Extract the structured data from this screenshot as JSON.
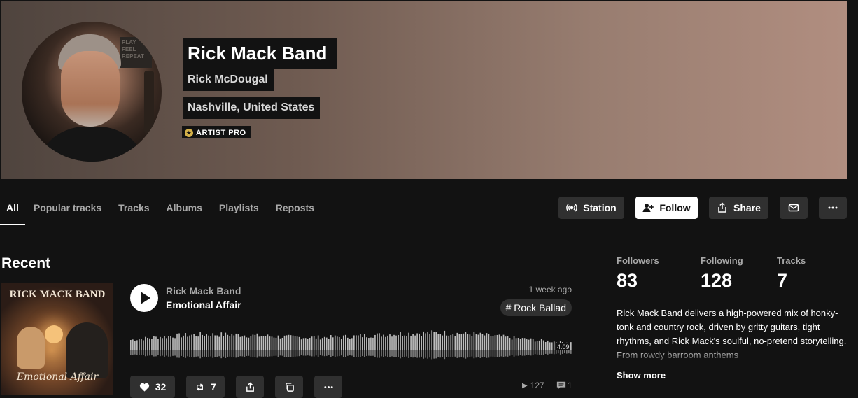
{
  "header": {
    "artist_name": "Rick Mack Band",
    "real_name": "Rick McDougal",
    "location": "Nashville, United States",
    "badge": "ARTIST PRO",
    "avatar_sign_text": "PLAY FEEL REPEAT"
  },
  "tabs": [
    {
      "label": "All",
      "active": true
    },
    {
      "label": "Popular tracks"
    },
    {
      "label": "Tracks"
    },
    {
      "label": "Albums"
    },
    {
      "label": "Playlists"
    },
    {
      "label": "Reposts"
    }
  ],
  "actions": {
    "station_label": "Station",
    "follow_label": "Follow",
    "share_label": "Share",
    "message_icon": "mail-icon",
    "more_icon": "more-icon"
  },
  "recent": {
    "heading": "Recent",
    "cover_title": "RICK MACK BAND",
    "cover_footer": "Emotional Affair",
    "track": {
      "artist": "Rick Mack Band",
      "title": "Emotional Affair",
      "posted": "1 week ago",
      "tag": "# Rock Ballad",
      "duration": "4:09",
      "likes": "32",
      "reposts": "7",
      "plays": "127",
      "comments": "1"
    }
  },
  "stats": {
    "followers_label": "Followers",
    "followers": "83",
    "following_label": "Following",
    "following": "128",
    "tracks_label": "Tracks",
    "tracks": "7"
  },
  "bio": {
    "text": "Rick Mack Band delivers a high-powered mix of honky-tonk and country rock, driven by gritty guitars, tight rhythms, and Rick Mack's soulful, no-pretend storytelling. From rowdy barroom anthems",
    "show_more": "Show more"
  },
  "colors": {
    "background": "#121212",
    "button": "#303030",
    "banner_left": "#4f443e",
    "banner_right": "#b18e80"
  }
}
